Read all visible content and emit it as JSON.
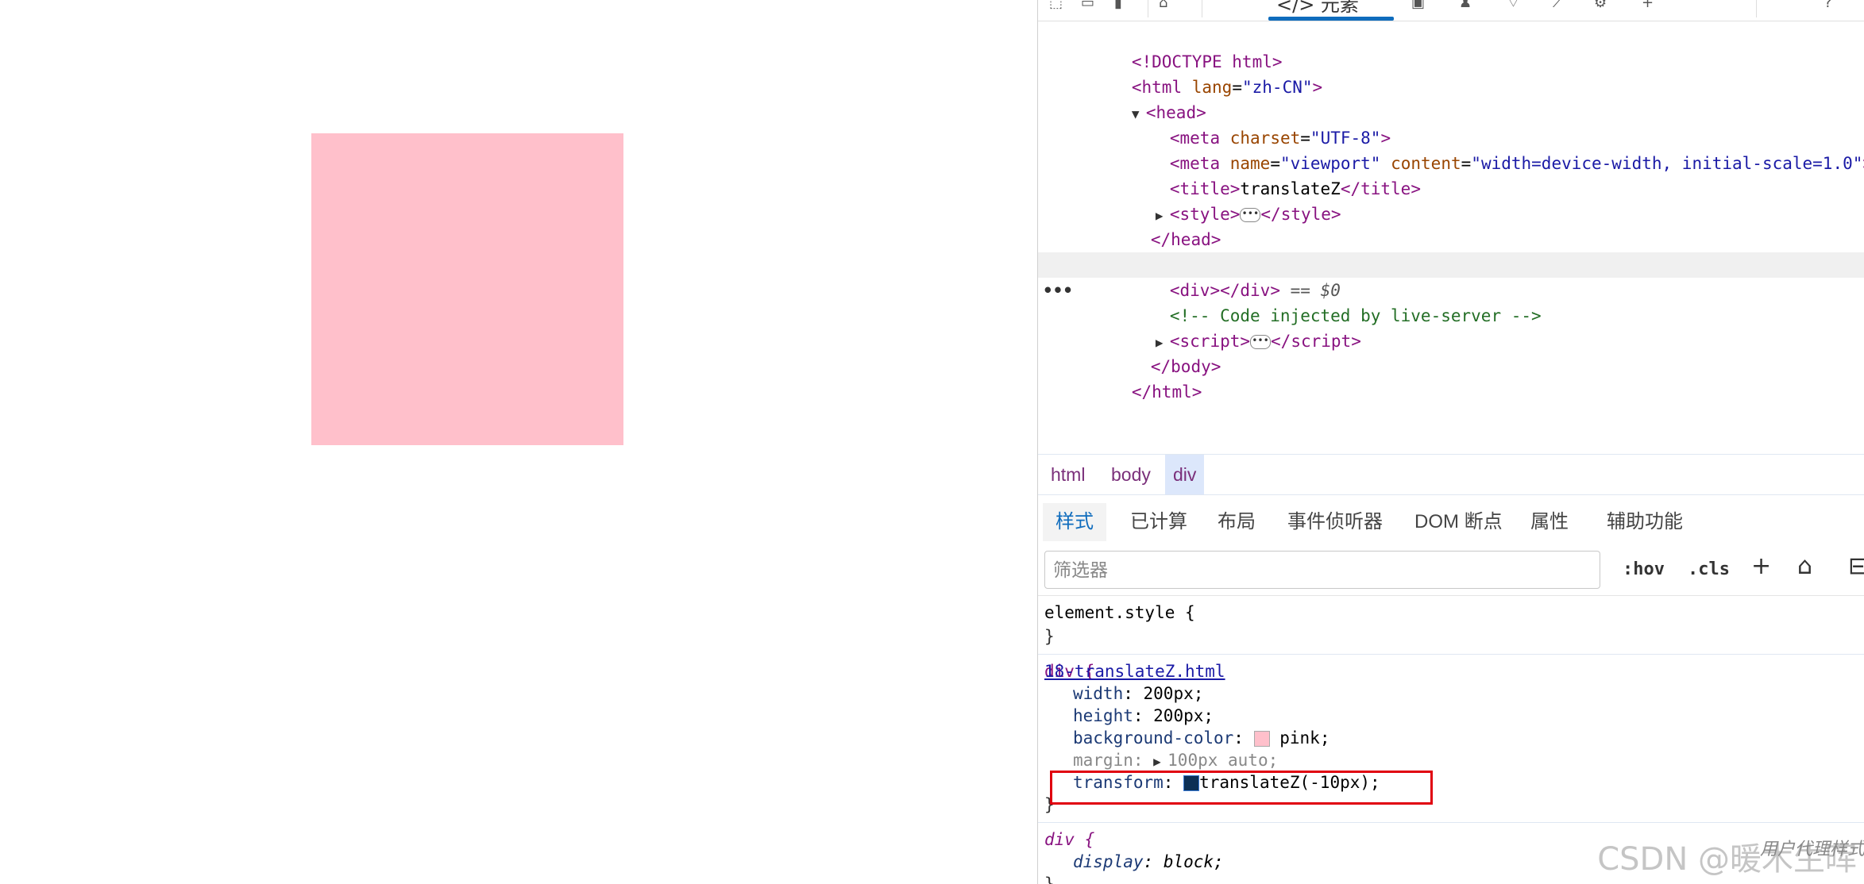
{
  "devtools": {
    "active_tab_label": "</> 元素",
    "dom": {
      "doctype": "<!DOCTYPE html>",
      "html_open": {
        "tag": "html",
        "attr": "lang",
        "val": "zh-CN"
      },
      "head_tag": "head",
      "meta1": {
        "tag": "meta",
        "attr": "charset",
        "val": "UTF-8"
      },
      "meta2": {
        "tag": "meta",
        "attr1": "name",
        "val1": "viewport",
        "attr2": "content",
        "val2": "width=device-width, initial-scale=1.0"
      },
      "title_text": "translateZ",
      "style_tag": "style",
      "body_tag": "body",
      "div_tag": "div",
      "selected_marker": "== $0",
      "comment": "<!-- Code injected by live-server -->",
      "script_tag": "script"
    },
    "breadcrumbs": [
      "html",
      "body",
      "div"
    ],
    "subtabs": [
      "样式",
      "已计算",
      "布局",
      "事件侦听器",
      "DOM 断点",
      "属性",
      "辅助功能"
    ],
    "filter": {
      "placeholder": "筛选器",
      "hov": ":hov",
      "cls": ".cls"
    },
    "styles": {
      "element_style": "element.style {",
      "close": "}",
      "rule1": {
        "selector": "div {",
        "source": "18-translateZ.html",
        "props": [
          {
            "name": "width",
            "value": "200px;"
          },
          {
            "name": "height",
            "value": "200px;"
          },
          {
            "name": "background-color",
            "value": "pink;"
          },
          {
            "name": "margin",
            "value": "100px auto;"
          },
          {
            "name": "transform",
            "value": "translateZ(-10px);"
          }
        ]
      },
      "rule2": {
        "selector": "div {",
        "props": [
          {
            "name": "display",
            "value": "block;"
          }
        ]
      }
    },
    "watermark": "CSDN @暖木生晖",
    "overlay_text": "用户代理样式"
  },
  "colors": {
    "pink": "#ffc0cb",
    "accent": "#0f6cbd",
    "highlight": "#e0000f"
  }
}
